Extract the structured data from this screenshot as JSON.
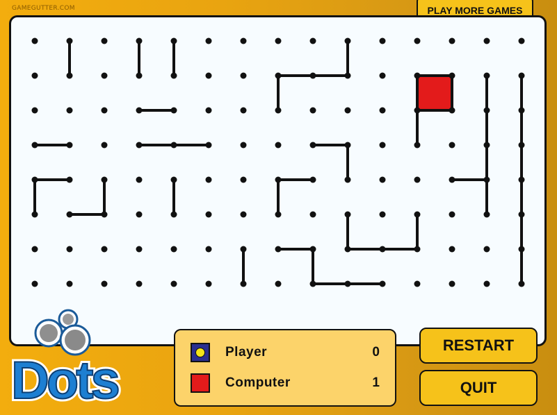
{
  "site_label": "GAMEGUTTER.COM",
  "header": {
    "more_games_label": "PLAY MORE GAMES"
  },
  "logo": {
    "text": "Dots"
  },
  "board": {
    "columns": 15,
    "rows": 8,
    "lines": [
      [
        1,
        0,
        1,
        1
      ],
      [
        3,
        0,
        3,
        1
      ],
      [
        4,
        0,
        4,
        1
      ],
      [
        9,
        0,
        9,
        1
      ],
      [
        7,
        1,
        8,
        1
      ],
      [
        8,
        1,
        9,
        1
      ],
      [
        7,
        1,
        7,
        2
      ],
      [
        11,
        1,
        12,
        1
      ],
      [
        11,
        1,
        11,
        2
      ],
      [
        12,
        1,
        12,
        2
      ],
      [
        11,
        2,
        12,
        2
      ],
      [
        13,
        1,
        13,
        2
      ],
      [
        14,
        1,
        14,
        2
      ],
      [
        3,
        2,
        4,
        2
      ],
      [
        11,
        2,
        11,
        3
      ],
      [
        13,
        2,
        13,
        3
      ],
      [
        14,
        2,
        14,
        3
      ],
      [
        0,
        3,
        1,
        3
      ],
      [
        3,
        3,
        4,
        3
      ],
      [
        4,
        3,
        5,
        3
      ],
      [
        8,
        3,
        9,
        3
      ],
      [
        9,
        3,
        9,
        4
      ],
      [
        13,
        3,
        13,
        4
      ],
      [
        14,
        3,
        14,
        4
      ],
      [
        0,
        4,
        1,
        4
      ],
      [
        0,
        4,
        0,
        5
      ],
      [
        2,
        4,
        2,
        5
      ],
      [
        4,
        4,
        4,
        5
      ],
      [
        7,
        4,
        8,
        4
      ],
      [
        7,
        4,
        7,
        5
      ],
      [
        12,
        4,
        13,
        4
      ],
      [
        13,
        4,
        13,
        5
      ],
      [
        14,
        4,
        14,
        5
      ],
      [
        1,
        5,
        2,
        5
      ],
      [
        9,
        5,
        9,
        6
      ],
      [
        11,
        5,
        11,
        6
      ],
      [
        14,
        5,
        14,
        6
      ],
      [
        7,
        6,
        8,
        6
      ],
      [
        8,
        6,
        8,
        7
      ],
      [
        9,
        6,
        10,
        6
      ],
      [
        10,
        6,
        11,
        6
      ],
      [
        6,
        6,
        6,
        7
      ],
      [
        14,
        6,
        14,
        7
      ],
      [
        8,
        7,
        9,
        7
      ],
      [
        9,
        7,
        10,
        7
      ]
    ],
    "filled_boxes": [
      {
        "col": 11,
        "row": 1,
        "owner": "computer"
      }
    ]
  },
  "colors": {
    "player": "#2b2f8f",
    "player_dot": "#f5e51a",
    "computer": "#e31b1b",
    "accent": "#f6c21a"
  },
  "scoreboard": {
    "player": {
      "name": "Player",
      "score": "0",
      "icon": "blue-square-yellow-dot-icon"
    },
    "computer": {
      "name": "Computer",
      "score": "1",
      "icon": "red-square-icon"
    }
  },
  "buttons": {
    "restart": "RESTART",
    "quit": "QUIT"
  }
}
